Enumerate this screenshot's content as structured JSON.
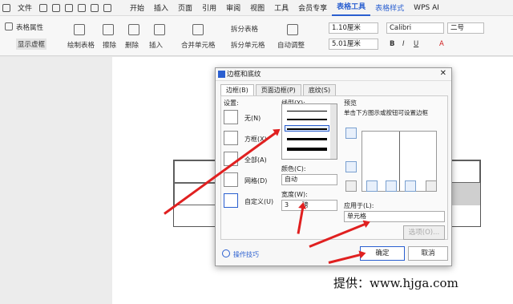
{
  "menubar": {
    "file": "文件",
    "tabs": [
      "开始",
      "插入",
      "页面",
      "引用",
      "审阅",
      "视图",
      "工具",
      "会员专享"
    ],
    "table_tools": "表格工具",
    "table_style": "表格样式",
    "wps_ai": "WPS AI"
  },
  "toolbar": {
    "table_props": "表格属性",
    "show_grid": "显示虚框",
    "draw_table": "绘制表格",
    "erase": "擦除",
    "delete": "删除",
    "insert": "插入",
    "merge_cells": "合并单元格",
    "split_table": "拆分表格",
    "split_cells": "拆分单元格",
    "auto_fit": "自动调整",
    "height": "1.10厘米",
    "width": "5.01厘米",
    "font": "Calibri",
    "size": "二号"
  },
  "dialog": {
    "title": "边框和底纹",
    "tabs": [
      "边框(B)",
      "页面边框(P)",
      "底纹(S)"
    ],
    "settings_label": "设置:",
    "presets": [
      "无(N)",
      "方框(X)",
      "全部(A)",
      "网格(D)",
      "自定义(U)"
    ],
    "style_label": "线型(Y):",
    "color_label": "颜色(C):",
    "color_value": "自动",
    "width_label": "宽度(W):",
    "width_value": "3",
    "width_unit": "磅",
    "preview_label": "预览",
    "preview_hint": "单击下方图示或按钮可设置边框",
    "apply_label": "应用于(L):",
    "apply_value": "单元格",
    "options": "选项(O)...",
    "tips": "操作技巧",
    "ok": "确定",
    "cancel": "取消"
  },
  "credit": "提供：www.hjga.com"
}
